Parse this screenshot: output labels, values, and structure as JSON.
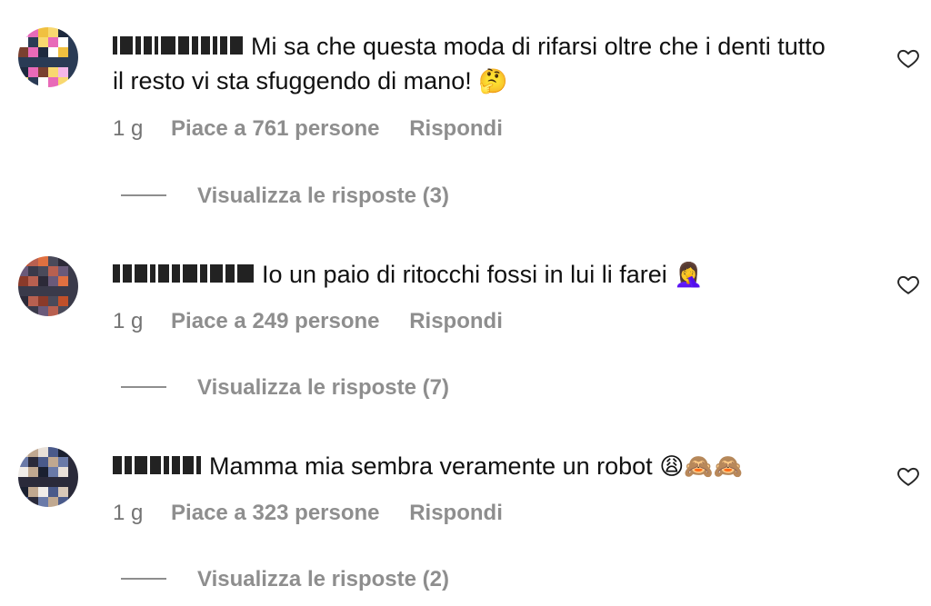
{
  "comments": [
    {
      "text": "Mi sa che questa moda di rifarsi oltre che i denti tutto il resto vi sta sfuggendo di mano!",
      "emoji": "🤔",
      "time": "1 g",
      "likes": "Piace a 761 persone",
      "reply": "Rispondi",
      "view_replies": "Visualizza le risposte (3)",
      "avatar_colors": [
        "#f4b6e8",
        "#2a3b55",
        "#f0c040",
        "#ffffff",
        "#1e2a3f",
        "#e86ab8",
        "#7a4030",
        "#f8d870"
      ]
    },
    {
      "text": "Io un paio di ritocchi fossi in lui li farei",
      "emoji": "🤦‍♀️",
      "time": "1 g",
      "likes": "Piace a 249 persone",
      "reply": "Rispondi",
      "view_replies": "Visualizza le risposte (7)",
      "avatar_colors": [
        "#c0502a",
        "#3a3a4a",
        "#e07040",
        "#6a5a7a",
        "#2c2a38",
        "#b86050",
        "#8a3a2a",
        "#4a4a5a"
      ]
    },
    {
      "text": "Mamma mia sembra veramente un robot",
      "emoji": "😩🙈🙈",
      "time": "1 g",
      "likes": "Piace a 323 persone",
      "reply": "Rispondi",
      "view_replies": "Visualizza le risposte (2)",
      "avatar_colors": [
        "#d8c8b8",
        "#2a2a3a",
        "#e8e0d8",
        "#6a7aa8",
        "#1a2030",
        "#c0a890",
        "#f0ece8",
        "#4a5a8a"
      ]
    }
  ],
  "icons": {
    "like": "heart-icon"
  }
}
